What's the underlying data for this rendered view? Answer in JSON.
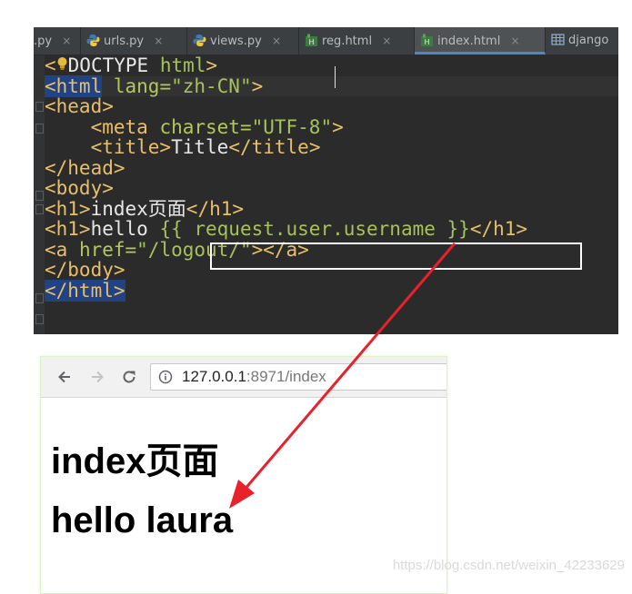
{
  "editor": {
    "tabs": [
      {
        "label": ".py",
        "icon": "python-file-icon",
        "active": false
      },
      {
        "label": "urls.py",
        "icon": "python-file-icon",
        "active": false
      },
      {
        "label": "views.py",
        "icon": "python-file-icon",
        "active": false
      },
      {
        "label": "reg.html",
        "icon": "html-file-icon",
        "active": false
      },
      {
        "label": "index.html",
        "icon": "html-file-icon",
        "active": true
      },
      {
        "label": "django",
        "icon": "database-table-icon",
        "active": false
      }
    ],
    "close_glyph": "×",
    "code": {
      "l1_open": "<",
      "l1_rest": "DOCTYPE ",
      "l1_html": "html",
      "l1_close": ">",
      "l2_tag": "<html",
      "l2_attr": "lang=",
      "l2_val": "\"zh-CN\"",
      "l2_close": ">",
      "l3": "<head>",
      "l4_tag": "<meta ",
      "l4_attr": "charset=",
      "l4_val": "\"UTF-8\"",
      "l4_close": ">",
      "l5_open": "<title>",
      "l5_text": "Title",
      "l5_close": "</title>",
      "l6": "</head>",
      "l7": "<body>",
      "l8_open": "<h1>",
      "l8_text": "index页面",
      "l8_close": "</h1>",
      "l9_open": "<h1>",
      "l9_text": "hello ",
      "l9_tmpl": "{{ request.user.username }}",
      "l9_close": "</h1>",
      "l10_tag": "<a ",
      "l10_attr": "href=",
      "l10_val": "\"/logout/\"",
      "l10_close": "></a>",
      "l11": "</body>",
      "l12": "</html>"
    }
  },
  "browser": {
    "url_host": "127.0.0.1",
    "url_path": ":8971/index",
    "heading1": "index页面",
    "heading2": "hello laura"
  },
  "watermark": "https://blog.csdn.net/weixin_42233629",
  "colors": {
    "arrow": "#e8212a",
    "tag": "#e8bf6a",
    "attr_value": "#a5c25c",
    "selection": "#214283"
  }
}
